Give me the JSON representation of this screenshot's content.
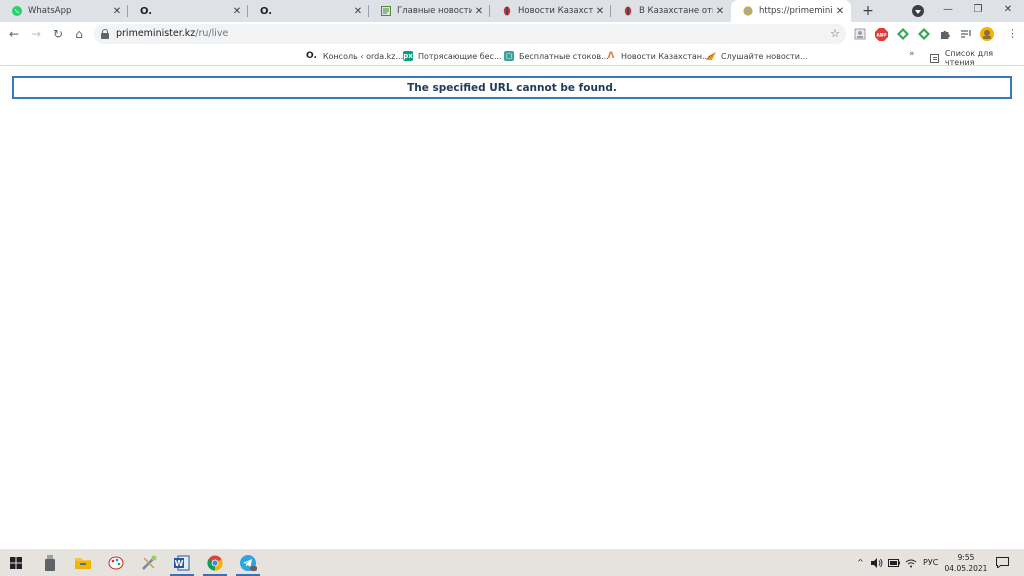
{
  "tabs": [
    {
      "title": "WhatsApp",
      "icon": "whatsapp-icon"
    },
    {
      "title": "",
      "icon": "orda-icon"
    },
    {
      "title": "",
      "icon": "orda-icon"
    },
    {
      "title": "Главные новости Каз",
      "icon": "news-icon"
    },
    {
      "title": "Новости Казахстана и",
      "icon": "emblem-icon"
    },
    {
      "title": "В Казахстане отмечае",
      "icon": "emblem-icon"
    },
    {
      "title": "https://primeminister.",
      "icon": "globe-icon",
      "active": true
    }
  ],
  "tab_orda_glyph": "O.",
  "tab_close_glyph": "✕",
  "new_tab_glyph": "+",
  "window_controls": {
    "minimize": "—",
    "maximize": "❐",
    "close": "✕"
  },
  "toolbar": {
    "back": "←",
    "forward": "→",
    "reload": "↻",
    "home": "⌂",
    "url_host": "primeminister.kz",
    "url_path": "/ru/live",
    "star": "☆",
    "menu": "⋮"
  },
  "extensions": [
    {
      "name": "profile-extension-icon",
      "label": "",
      "color": "#9aa0a6"
    },
    {
      "name": "adblock-icon",
      "label": "ABP",
      "color": "#e53935"
    },
    {
      "name": "green-diamond-icon",
      "label": "",
      "color": "#34a853"
    },
    {
      "name": "green-diamond-icon-2",
      "label": "",
      "color": "#34a853"
    },
    {
      "name": "puzzle-icon",
      "label": "",
      "color": "#5f6368"
    },
    {
      "name": "playlist-icon",
      "label": "",
      "color": "#5f6368"
    },
    {
      "name": "avatar",
      "label": "",
      "color": "#f4b400"
    }
  ],
  "bookmarks": [
    {
      "label": "Консоль ‹ orda.kz...",
      "icon": "O.",
      "icon_color": "#202124"
    },
    {
      "label": "Потрясающие бес...",
      "icon": "px",
      "icon_color": "#05a081"
    },
    {
      "label": "Бесплатные стоков...",
      "icon": "▢",
      "icon_color": "#3aa39a"
    },
    {
      "label": "Новости Казахстан...",
      "icon": "Λ",
      "icon_color": "#e8793a"
    },
    {
      "label": "Слушайте новости...",
      "icon": "▰",
      "icon_color": "#f29900"
    }
  ],
  "bookmarks_more": "»",
  "reading_list_label": "Список для чтения",
  "page": {
    "error_message": "The specified URL cannot be found."
  },
  "taskbar": {
    "language": "РУС",
    "time": "9:55",
    "date": "04.05.2021",
    "tray_chevron": "^"
  }
}
